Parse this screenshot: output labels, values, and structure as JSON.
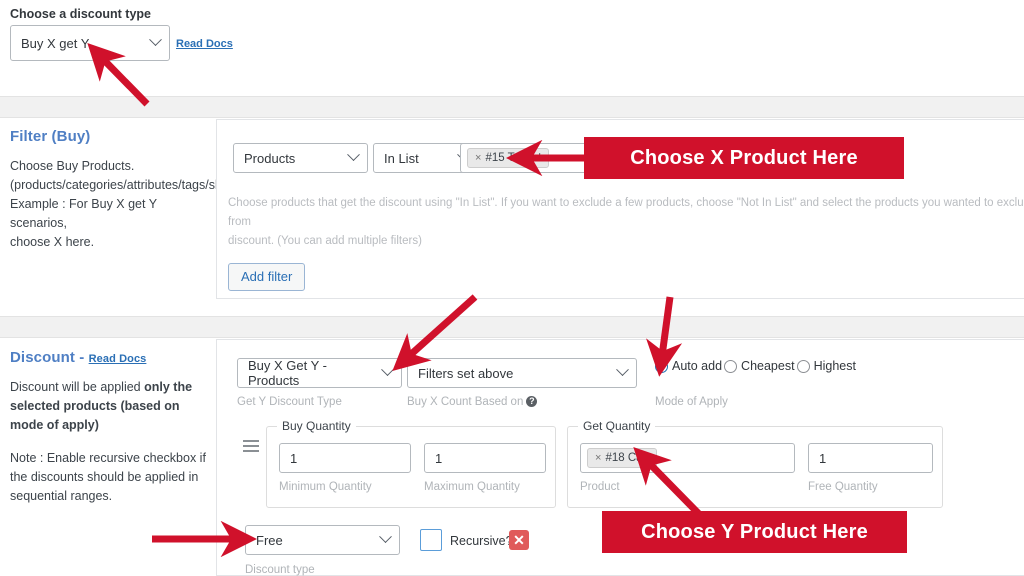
{
  "top": {
    "label": "Choose a discount type",
    "select_value": "Buy X get Y",
    "read_docs": "Read Docs"
  },
  "filter_section": {
    "title": "Filter (Buy)",
    "desc_line1": "Choose Buy Products.",
    "desc_line2": "(products/categories/attributes/tags/sku",
    "desc_line3": "Example : For Buy X get Y scenarios,",
    "desc_line4": "choose X here.",
    "row": {
      "subject_value": "Products",
      "operator_value": "In List",
      "chip_x": "×",
      "chip_label": "#15 T-Shirt"
    },
    "helper_line1": "Choose products that get the discount using \"In List\". If you want to exclude a few products, choose \"Not In List\" and select the products you wanted to exclude from",
    "helper_line2": "discount. (You can add multiple filters)",
    "add_filter_label": "Add filter"
  },
  "discount_section": {
    "title": "Discount -",
    "read_docs": "Read Docs",
    "desc1_a": "Discount will be applied ",
    "desc1_b": "only the selected products (based on mode of apply)",
    "desc2": "Note : Enable recursive checkbox if the discounts should be applied in sequential ranges.",
    "get_y_type_value": "Buy X Get Y - Products",
    "get_y_type_sublabel": "Get Y Discount Type",
    "count_based_value": "Filters set above",
    "count_based_sublabel": "Buy X Count Based on",
    "mode": {
      "options": [
        "Auto add",
        "Cheapest",
        "Highest"
      ],
      "selected": "Auto add",
      "sublabel": "Mode of Apply"
    },
    "buy_quantity": {
      "legend": "Buy Quantity",
      "min_value": "1",
      "min_sublabel": "Minimum Quantity",
      "max_value": "1",
      "max_sublabel": "Maximum Quantity"
    },
    "get_quantity": {
      "legend": "Get Quantity",
      "chip_x": "×",
      "chip_label": "#18 Cap",
      "product_sublabel": "Product",
      "free_qty_value": "1",
      "free_qty_sublabel": "Free Quantity"
    },
    "discount_type": {
      "value": "Free",
      "sublabel": "Discount type"
    },
    "recursive": {
      "label": "Recursive?",
      "checked": false
    },
    "delete_label": "✕"
  },
  "annotations": {
    "callout_x": "Choose X Product Here",
    "callout_y": "Choose Y Product Here",
    "accent_color": "#d0112b"
  }
}
